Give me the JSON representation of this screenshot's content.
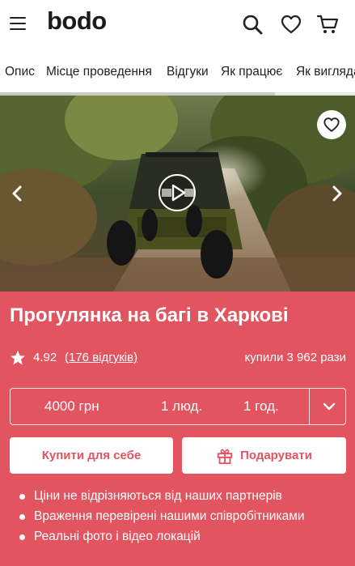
{
  "header": {
    "logo": "bodo",
    "icons": [
      "menu-icon",
      "search-icon",
      "heart-icon",
      "cart-icon"
    ]
  },
  "tabs": [
    {
      "label": "Опис"
    },
    {
      "label": "Місце проведення"
    },
    {
      "label": "Відгуки"
    },
    {
      "label": "Як працює"
    },
    {
      "label": "Як виглядає"
    }
  ],
  "hero": {
    "icons": [
      "arrow-left-icon",
      "arrow-right-icon",
      "play-icon",
      "heart-icon"
    ]
  },
  "product": {
    "title": "Прогулянка на багі в Харкові",
    "rating": "4.92",
    "reviews": "(176 відгуків)",
    "bought": "купили 3 962 рази"
  },
  "selector": {
    "price": "4000 грн",
    "people": "1 люд.",
    "duration": "1 год."
  },
  "actions": {
    "buy_label": "Купити для себе",
    "gift_label": "Подарувати"
  },
  "benefits": [
    "Ціни не відрізняються від наших партнерів",
    "Враження перевірені нашими співробітниками",
    "Реальні фото і відео локацій"
  ],
  "colors": {
    "accent": "#e25560",
    "panel_text": "#ffffff",
    "header_text": "#1a1a1a"
  }
}
